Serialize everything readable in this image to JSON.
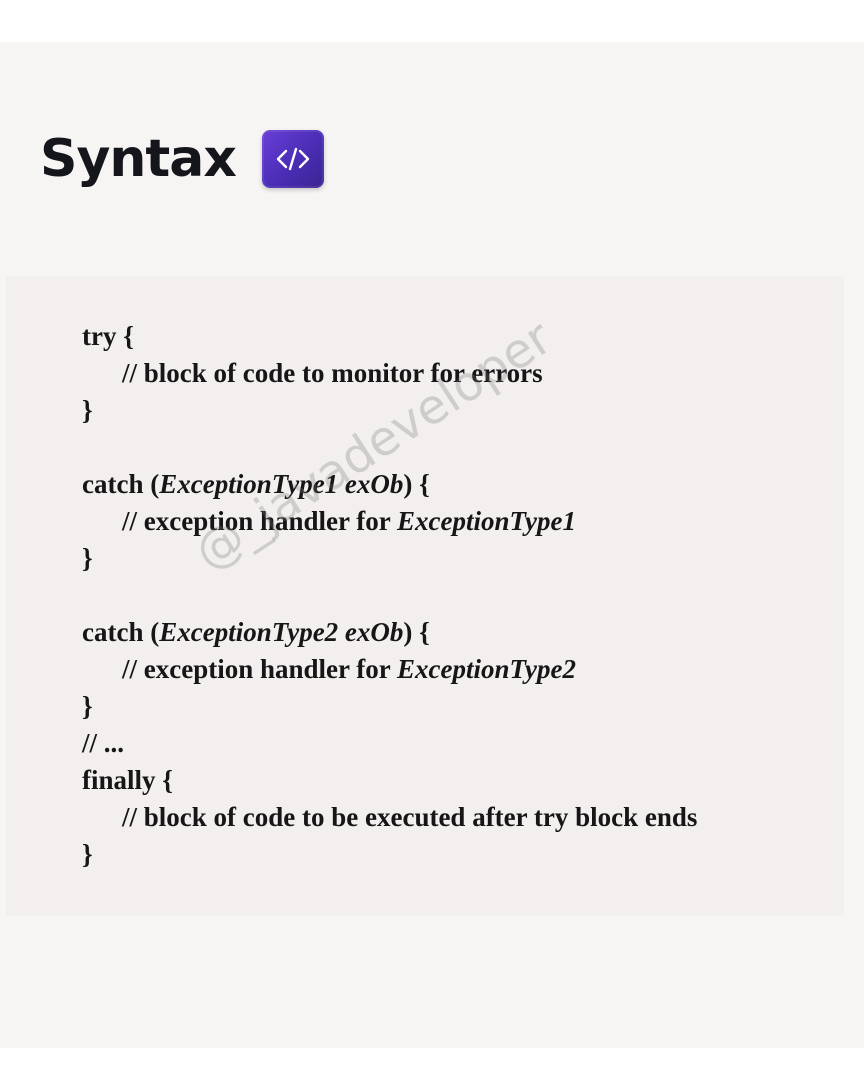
{
  "heading": {
    "title": "Syntax",
    "icon": "code-icon",
    "badge_color": "#5a34c8"
  },
  "code": {
    "try_open": "try {",
    "try_comment": "// block of code to monitor for errors",
    "try_close": "}",
    "catch1_prefix": "catch (",
    "catch1_type": "ExceptionType1 exOb",
    "catch1_suffix": ") {",
    "catch1_comment_prefix": "// exception handler for ",
    "catch1_comment_type": "ExceptionType1",
    "catch1_close": "}",
    "catch2_prefix": "catch (",
    "catch2_type": "ExceptionType2 exOb",
    "catch2_suffix": ") {",
    "catch2_comment_prefix": "// exception handler for ",
    "catch2_comment_type": "ExceptionType2",
    "catch2_close": "}",
    "ellipsis_comment": "// ...",
    "finally_open": "finally {",
    "finally_comment": "// block of code to be executed after try block ends",
    "finally_close": "}"
  },
  "watermark": "@_javadeveloper"
}
